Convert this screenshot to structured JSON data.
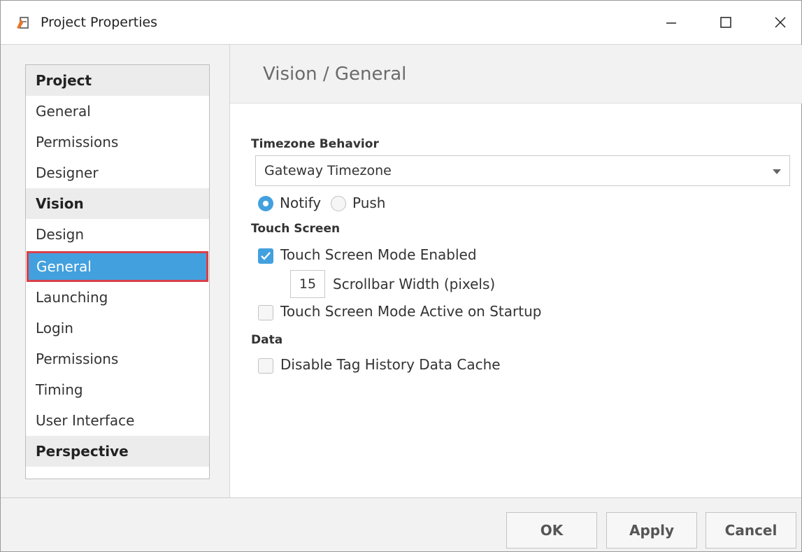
{
  "window": {
    "title": "Project Properties",
    "app_icon": "ignition-designer-icon",
    "controls": [
      "minimize-icon",
      "maximize-icon",
      "close-icon"
    ]
  },
  "sidebar": {
    "items": [
      {
        "label": "Project",
        "type": "header"
      },
      {
        "label": "General",
        "type": "item"
      },
      {
        "label": "Permissions",
        "type": "item"
      },
      {
        "label": "Designer",
        "type": "item"
      },
      {
        "label": "Vision",
        "type": "header"
      },
      {
        "label": "Design",
        "type": "item"
      },
      {
        "label": "General",
        "type": "item",
        "selected": true
      },
      {
        "label": "Launching",
        "type": "item"
      },
      {
        "label": "Login",
        "type": "item"
      },
      {
        "label": "Permissions",
        "type": "item"
      },
      {
        "label": "Timing",
        "type": "item"
      },
      {
        "label": "User Interface",
        "type": "item"
      },
      {
        "label": "Perspective",
        "type": "header"
      }
    ]
  },
  "main": {
    "title": "Vision / General",
    "timezone": {
      "label": "Timezone Behavior",
      "selected": "Gateway Timezone",
      "radio_notify": "Notify",
      "radio_push": "Push",
      "radio_selected": "Notify"
    },
    "touch_screen": {
      "label": "Touch Screen",
      "mode_enabled_label": "Touch Screen Mode Enabled",
      "mode_enabled_checked": true,
      "scrollbar_width_value": "15",
      "scrollbar_width_label": "Scrollbar Width (pixels)",
      "active_on_startup_label": "Touch Screen Mode Active on Startup",
      "active_on_startup_checked": false
    },
    "data": {
      "label": "Data",
      "disable_cache_label": "Disable Tag History Data Cache",
      "disable_cache_checked": false
    }
  },
  "footer": {
    "ok_label": "OK",
    "apply_label": "Apply",
    "cancel_label": "Cancel"
  },
  "colors": {
    "accent": "#43a0de",
    "selection_outline": "#d9404a",
    "panel_bg": "#f2f2f2"
  }
}
